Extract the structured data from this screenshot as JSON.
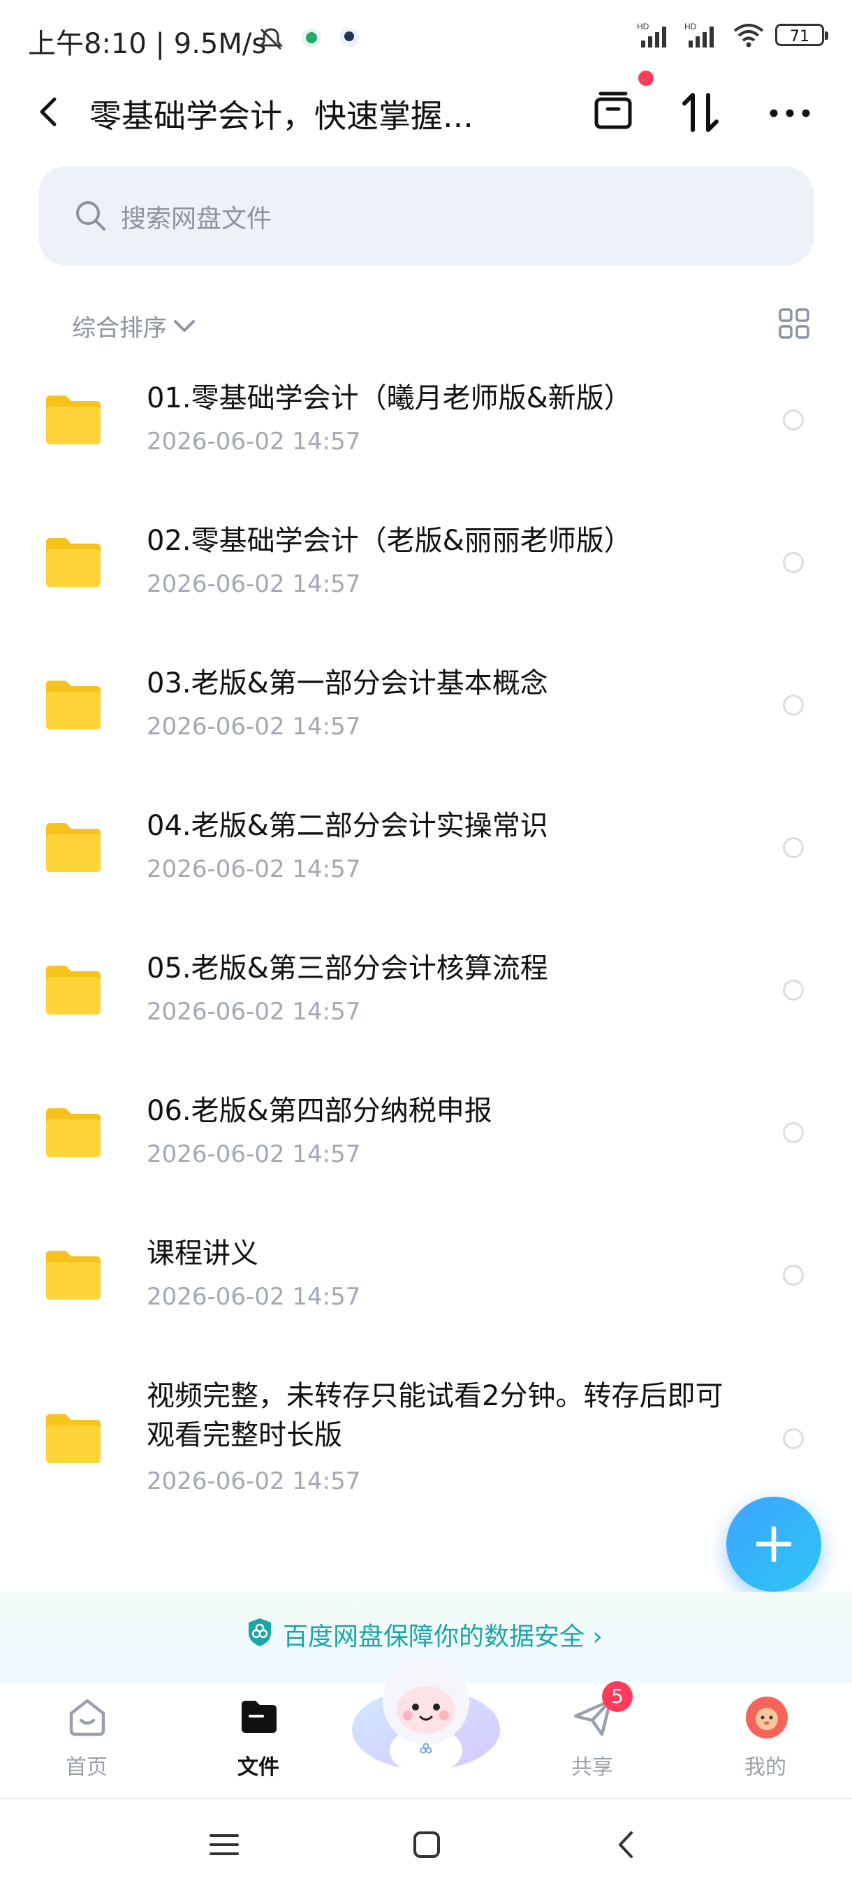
{
  "status_bar": {
    "time": "上午8:10",
    "separator": "|",
    "speed": "9.5M/s",
    "battery": "71"
  },
  "header": {
    "title": "零基础学会计，快速掌握..."
  },
  "search": {
    "placeholder": "搜索网盘文件"
  },
  "sort": {
    "label": "综合排序"
  },
  "files": [
    {
      "name": "01.零基础学会计（曦月老师版&新版）",
      "date": "2026-06-02  14:57"
    },
    {
      "name": "02.零基础学会计（老版&丽丽老师版）",
      "date": "2026-06-02  14:57"
    },
    {
      "name": "03.老版&第一部分会计基本概念",
      "date": "2026-06-02  14:57"
    },
    {
      "name": "04.老版&第二部分会计实操常识",
      "date": "2026-06-02  14:57"
    },
    {
      "name": "05.老版&第三部分会计核算流程",
      "date": "2026-06-02  14:57"
    },
    {
      "name": "06.老版&第四部分纳税申报",
      "date": "2026-06-02  14:57"
    },
    {
      "name": "课程讲义",
      "date": "2026-06-02  14:57"
    },
    {
      "name": "视频完整，未转存只能试看2分钟。转存后即可观看完整时长版",
      "date": "2026-06-02  14:57"
    }
  ],
  "banner": {
    "text": "百度网盘保障你的数据安全 ›"
  },
  "tabs": [
    {
      "label": "首页"
    },
    {
      "label": "文件"
    },
    {
      "label": "共享"
    },
    {
      "label": "我的"
    }
  ],
  "share_badge": "5",
  "colors": {
    "accent": "#3fa3ff",
    "folder": "#ffd43b",
    "badge": "#ff3b5c",
    "banner_text": "#1aa6a6"
  }
}
